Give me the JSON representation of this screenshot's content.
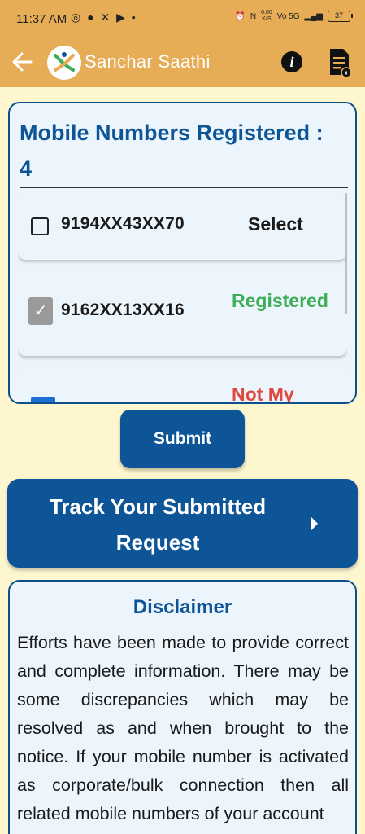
{
  "status_bar": {
    "time": "11:37 AM",
    "left_icons": [
      "whatsapp-icon",
      "chat-icon",
      "x-icon",
      "youtube-icon",
      "dot-icon"
    ],
    "net_speed": "0.00",
    "net_unit": "K/S",
    "network": "Vo 5G",
    "battery": "37"
  },
  "app_bar": {
    "title": "Sanchar Saathi",
    "accent_color": "#e6ad56"
  },
  "numbers_card": {
    "heading": "Mobile Numbers Registered : 4",
    "rows": [
      {
        "number": "9194XX43XX70",
        "status": "Select",
        "checked": false
      },
      {
        "number": "9162XX13XX16",
        "status": "Registered",
        "checked": true
      },
      {
        "number": "",
        "status": "Not My",
        "checked": false
      }
    ]
  },
  "actions": {
    "submit_label": "Submit",
    "track_label": "Track Your Submitted Request"
  },
  "disclaimer": {
    "title": "Disclaimer",
    "body": "Efforts have been made to provide correct and complete information. There may be some discrepancies which may be resolved as and when brought to the notice. If your mobile number is activated as corporate/bulk connection then all related mobile numbers of your account"
  },
  "colors": {
    "primary": "#0d5596",
    "registered": "#3cae55",
    "not_mine": "#e0483f",
    "background": "#fdf6cf"
  }
}
